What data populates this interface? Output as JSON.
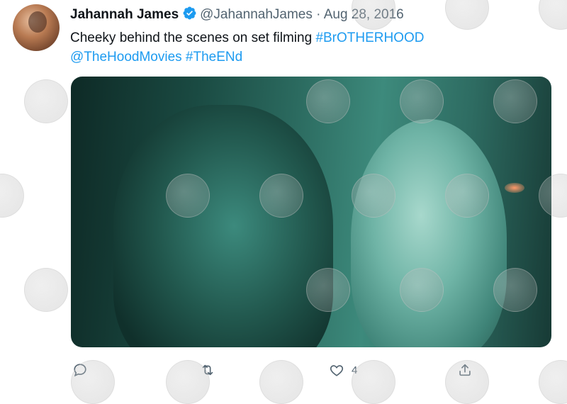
{
  "tweet": {
    "display_name": "Jahannah James",
    "handle": "@JahannahJames",
    "separator": "·",
    "date": "Aug 28, 2016",
    "text_plain": "Cheeky behind the scenes on set filming ",
    "hashtag_1": "#BrOTHERHOOD",
    "mention": "@TheHoodMovies",
    "hashtag_2": "#TheENd"
  },
  "actions": {
    "reply_icon": "reply-icon",
    "retweet_icon": "retweet-icon",
    "like_icon": "like-icon",
    "like_count": "4",
    "share_icon": "share-icon"
  },
  "colors": {
    "link": "#1d9bf0",
    "muted": "#536471",
    "verified": "#1d9bf0",
    "text": "#0f1419"
  }
}
